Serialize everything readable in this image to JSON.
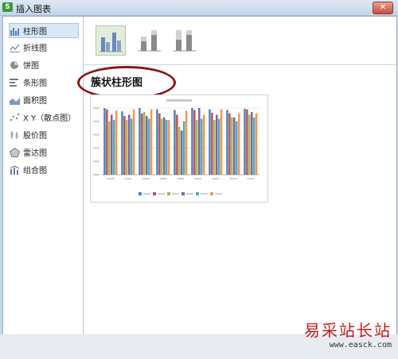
{
  "window": {
    "title": "插入图表",
    "app_icon": "S"
  },
  "sidebar": {
    "items": [
      {
        "label": "柱形图",
        "icon": "column-chart-icon"
      },
      {
        "label": "折线图",
        "icon": "line-chart-icon"
      },
      {
        "label": "饼图",
        "icon": "pie-chart-icon"
      },
      {
        "label": "条形图",
        "icon": "bar-chart-icon"
      },
      {
        "label": "面积图",
        "icon": "area-chart-icon"
      },
      {
        "label": "X Y（散点图）",
        "icon": "scatter-chart-icon"
      },
      {
        "label": "股价图",
        "icon": "stock-chart-icon"
      },
      {
        "label": "雷达图",
        "icon": "radar-chart-icon"
      },
      {
        "label": "组合图",
        "icon": "combo-chart-icon"
      }
    ],
    "selected": 0
  },
  "subtypes": [
    "clustered-column-icon",
    "stacked-column-icon",
    "percent-stacked-column-icon"
  ],
  "main": {
    "heading": "簇状柱形图"
  },
  "preview": {
    "series_colors": [
      "#4f81bd",
      "#c0504d",
      "#9bbb59",
      "#8064a2",
      "#4bacc6",
      "#f79646"
    ]
  },
  "chart_data": {
    "type": "bar",
    "categories": [
      "",
      "",
      "",
      "",
      "",
      "",
      "",
      "",
      ""
    ],
    "series": [
      {
        "values": [
          100,
          95,
          100,
          98,
          97,
          100,
          98,
          97,
          99
        ]
      },
      {
        "values": [
          98,
          88,
          92,
          92,
          90,
          97,
          93,
          92,
          98
        ]
      },
      {
        "values": [
          80,
          82,
          94,
          84,
          72,
          82,
          82,
          86,
          90
        ]
      },
      {
        "values": [
          90,
          90,
          88,
          86,
          66,
          100,
          90,
          86,
          94
        ]
      },
      {
        "values": [
          82,
          84,
          84,
          82,
          80,
          84,
          84,
          80,
          86
        ]
      },
      {
        "values": [
          96,
          98,
          98,
          82,
          96,
          90,
          98,
          92,
          92
        ]
      }
    ],
    "ylim": [
      0,
      100
    ],
    "grid": true,
    "legend": "bottom"
  },
  "watermark": {
    "line1": "易采站长站",
    "line2": "www.easck.com"
  }
}
